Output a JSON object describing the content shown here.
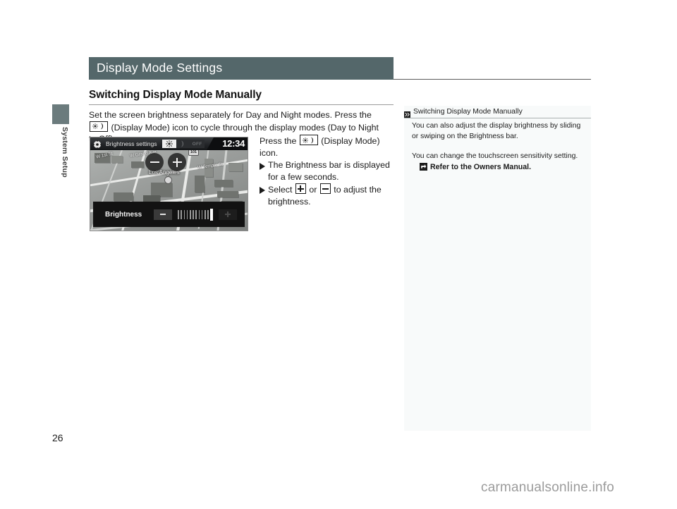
{
  "sidebar": {
    "tab_label": "System Setup",
    "tab_color": "#6b7b7d"
  },
  "page": {
    "number": "26",
    "watermark": "carmanualsonline.info"
  },
  "header": {
    "title": "Display Mode Settings",
    "bar_color": "#54676a"
  },
  "section": {
    "heading": "Switching Display Mode Manually"
  },
  "body": {
    "para_part1": "Set the screen brightness separately for Day and Night modes. Press the",
    "para_part2": "(Display Mode) icon to cycle through the display modes (Day to Night to Off)."
  },
  "right_column": {
    "intro_part1": "Press the",
    "intro_part2": "(Display Mode) icon.",
    "bullets": [
      {
        "text": "The Brightness bar is displayed for a few seconds."
      },
      {
        "text_part1": "Select",
        "text_part2": "or",
        "text_part3": "to adjust the brightness."
      }
    ]
  },
  "nav_screen": {
    "header_title": "Brightness settings",
    "gear_icon": "gear-icon",
    "mode_day_icon": "sun-icon",
    "mode_night_icon": "moon-icon",
    "mode_off_label": "OFF",
    "clock": "12:34",
    "zoom_out_label": "−",
    "zoom_in_label": "+",
    "city_label": "Los Angeles",
    "street_labels": [
      {
        "text": "W Grand Ave"
      },
      {
        "text": "W Temple St"
      },
      {
        "text": "W 1st St"
      }
    ],
    "highway_shield": "101",
    "brightness_label": "Brightness",
    "brightness_ticks": 12,
    "brightness_cursor_index": 11
  },
  "info_panel": {
    "head_icon": "double-chevron-icon",
    "head_title": "Switching Display Mode Manually",
    "para1": "You can also adjust the display brightness by sliding or swiping on the Brightness bar.",
    "para2": "You can change the touchscreen sensitivity setting.",
    "refer_icon": "arrow-reference-icon",
    "refer_text": "Refer to the Owners Manual.",
    "bg_color": "#f8fafa"
  }
}
